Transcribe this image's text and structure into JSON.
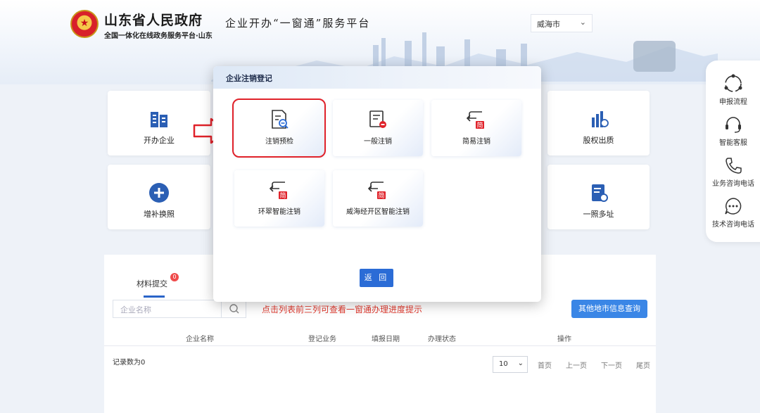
{
  "header": {
    "gov_title": "山东省人民政府",
    "gov_subtitle": "全国一体化在线政务服务平台·山东",
    "platform_title": "企业开办“一窗通”服务平台",
    "city_select": "威海市",
    "emblem_glyph": "★"
  },
  "rail": {
    "items": [
      {
        "label": "申报流程",
        "icon": "process-icon"
      },
      {
        "label": "智能客服",
        "icon": "headset-icon"
      },
      {
        "label": "业务咨询电话",
        "icon": "phone-icon"
      },
      {
        "label": "技术咨询电话",
        "icon": "chat-icon"
      }
    ]
  },
  "tiles": {
    "open_company": "开办企业",
    "equity_pledge": "股权出质",
    "replace_license": "增补换照",
    "multi_address": "一照多址"
  },
  "panel": {
    "tab_label": "材料提交",
    "tab_badge": "0",
    "search_placeholder": "企业名称",
    "hint": "点击列表前三列可查看一窗通办理进度提示",
    "query_button": "其他地市信息查询",
    "columns": [
      "企业名称",
      "登记业务",
      "填报日期",
      "办理状态",
      "操作"
    ],
    "record_count": "记录数为0",
    "page_size": "10",
    "pager": [
      "首页",
      "上一页",
      "下一页",
      "尾页"
    ]
  },
  "modal": {
    "title": "企业注销登记",
    "cards": [
      {
        "label": "注销预检",
        "icon": "document-search-icon"
      },
      {
        "label": "一般注销",
        "icon": "document-minus-icon"
      },
      {
        "label": "简易注销",
        "icon": "simple-exit-icon"
      },
      {
        "label": "环翠智能注销",
        "icon": "simple-exit-icon"
      },
      {
        "label": "威海经开区智能注销",
        "icon": "simple-exit-icon"
      }
    ],
    "return_button": "返 回",
    "simple_glyph": "简"
  },
  "colors": {
    "accent": "#2b6cd6",
    "highlight": "#e0222a",
    "hint": "#e03a2f"
  }
}
